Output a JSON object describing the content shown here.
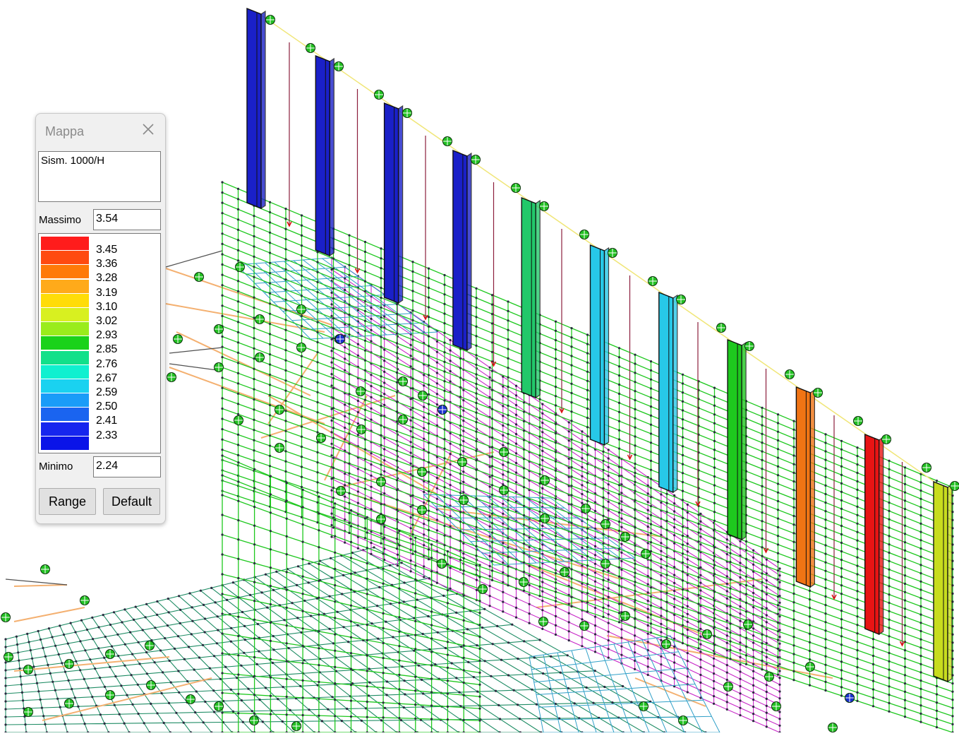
{
  "window": {
    "title": "Mappa",
    "load_case": "Sism. 1000/H",
    "max_label": "Massimo",
    "max_value": "3.54",
    "min_label": "Minimo",
    "min_value": "2.24",
    "range_button": "Range",
    "default_button": "Default"
  },
  "legend": [
    {
      "value": "3.45",
      "color": "#ff1c1c"
    },
    {
      "value": "3.36",
      "color": "#ff4a10"
    },
    {
      "value": "3.28",
      "color": "#ff7a08"
    },
    {
      "value": "3.19",
      "color": "#ffaa1a"
    },
    {
      "value": "3.10",
      "color": "#ffdc08"
    },
    {
      "value": "3.02",
      "color": "#d8f020"
    },
    {
      "value": "2.93",
      "color": "#9aec1c"
    },
    {
      "value": "2.85",
      "color": "#1ad21a"
    },
    {
      "value": "2.76",
      "color": "#12e08a"
    },
    {
      "value": "2.67",
      "color": "#10f0d0"
    },
    {
      "value": "2.59",
      "color": "#1ad2f0"
    },
    {
      "value": "2.50",
      "color": "#1a9cf8"
    },
    {
      "value": "2.41",
      "color": "#1a64f0"
    },
    {
      "value": "2.33",
      "color": "#1626ee"
    }
  ],
  "columns": [
    {
      "color": "#1a20c8"
    },
    {
      "color": "#1a20c8"
    },
    {
      "color": "#1a20c8"
    },
    {
      "color": "#1a20c8"
    },
    {
      "color": "#22c86a"
    },
    {
      "color": "#27c8e8"
    },
    {
      "color": "#27c8e8"
    },
    {
      "color": "#1ec81e"
    },
    {
      "color": "#f07414"
    },
    {
      "color": "#e81414"
    },
    {
      "color": "#c8dc1e"
    }
  ],
  "colors": {
    "mesh_green": "#1ec81e",
    "mesh_magenta": "#c828c8",
    "mesh_teal": "#1e8c64",
    "mesh_cyan": "#30a0c8",
    "brace_orange": "#f4b070",
    "node_dark": "#2a2a40",
    "rebar": "#8c1e3c",
    "top_edge": "#f0e678"
  }
}
